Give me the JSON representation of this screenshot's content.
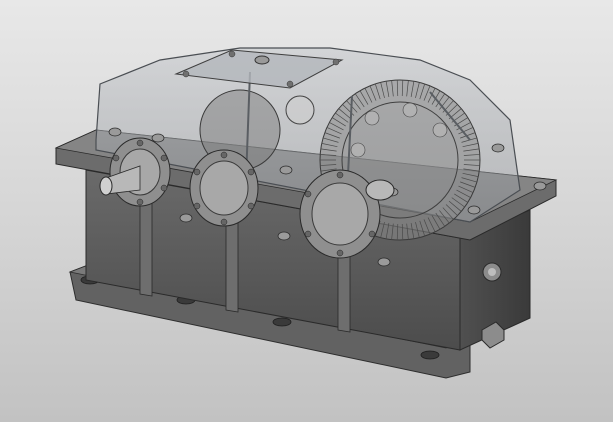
{
  "viewport": {
    "background_top": "#e8e8e8",
    "background_bottom": "#c2c2c2"
  },
  "model": {
    "housing_color": "#5a5a5a",
    "housing_dark": "#404040",
    "housing_light": "#707070",
    "cover_color": "#a9adb3",
    "gear_color": "#8a8a8a",
    "shaft_color": "#b8b8b8",
    "bolt_color": "#9a9a9a",
    "gear_teeth_count": 90
  }
}
